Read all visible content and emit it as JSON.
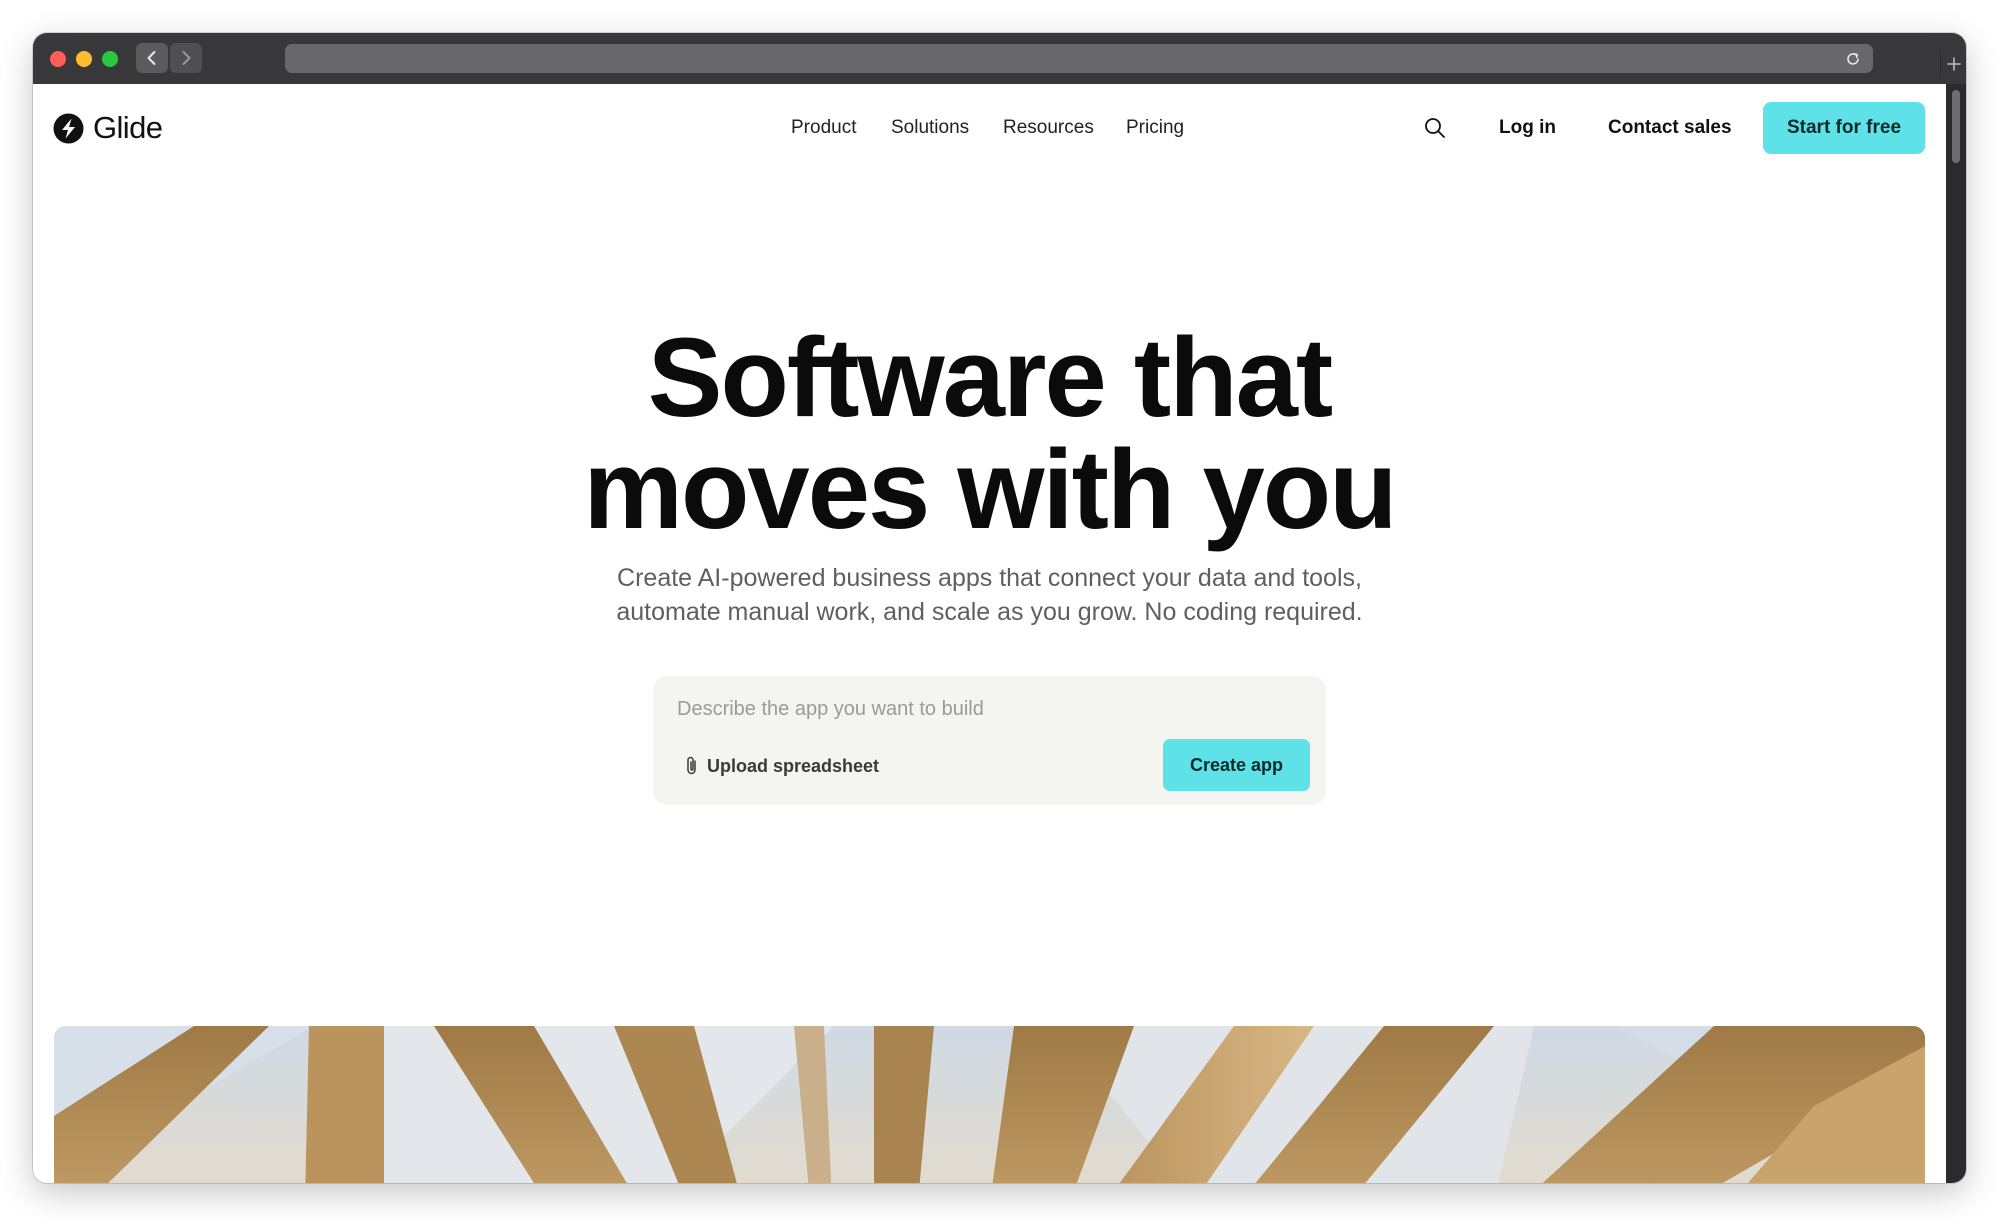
{
  "browser": {
    "window_controls": [
      "close",
      "minimize",
      "zoom"
    ],
    "icons": {
      "back": "chevron-left-icon",
      "forward": "chevron-right-icon",
      "reload": "reload-icon",
      "new_tab": "plus-icon"
    }
  },
  "header": {
    "brand": "Glide",
    "nav": [
      {
        "label": "Product"
      },
      {
        "label": "Solutions"
      },
      {
        "label": "Resources"
      },
      {
        "label": "Pricing"
      }
    ],
    "search_icon": "search-icon",
    "login": "Log in",
    "contact": "Contact sales",
    "cta": "Start for free"
  },
  "hero": {
    "headline_line1": "Software that",
    "headline_line2": "moves with you",
    "subtitle_line1": "Create AI-powered business apps that connect your data and tools,",
    "subtitle_line2": "automate manual work, and scale as you grow. No coding required.",
    "prompt": {
      "placeholder": "Describe the app you want to build",
      "value": "",
      "upload_label": "Upload spreadsheet",
      "upload_icon": "paperclip-icon",
      "create_label": "Create app"
    }
  },
  "colors": {
    "accent": "#5fe1e8",
    "text_primary": "#0b0b0b",
    "text_secondary": "#5f5f5f",
    "prompt_background": "#f4f4f0",
    "browser_chrome": "#38383b"
  }
}
